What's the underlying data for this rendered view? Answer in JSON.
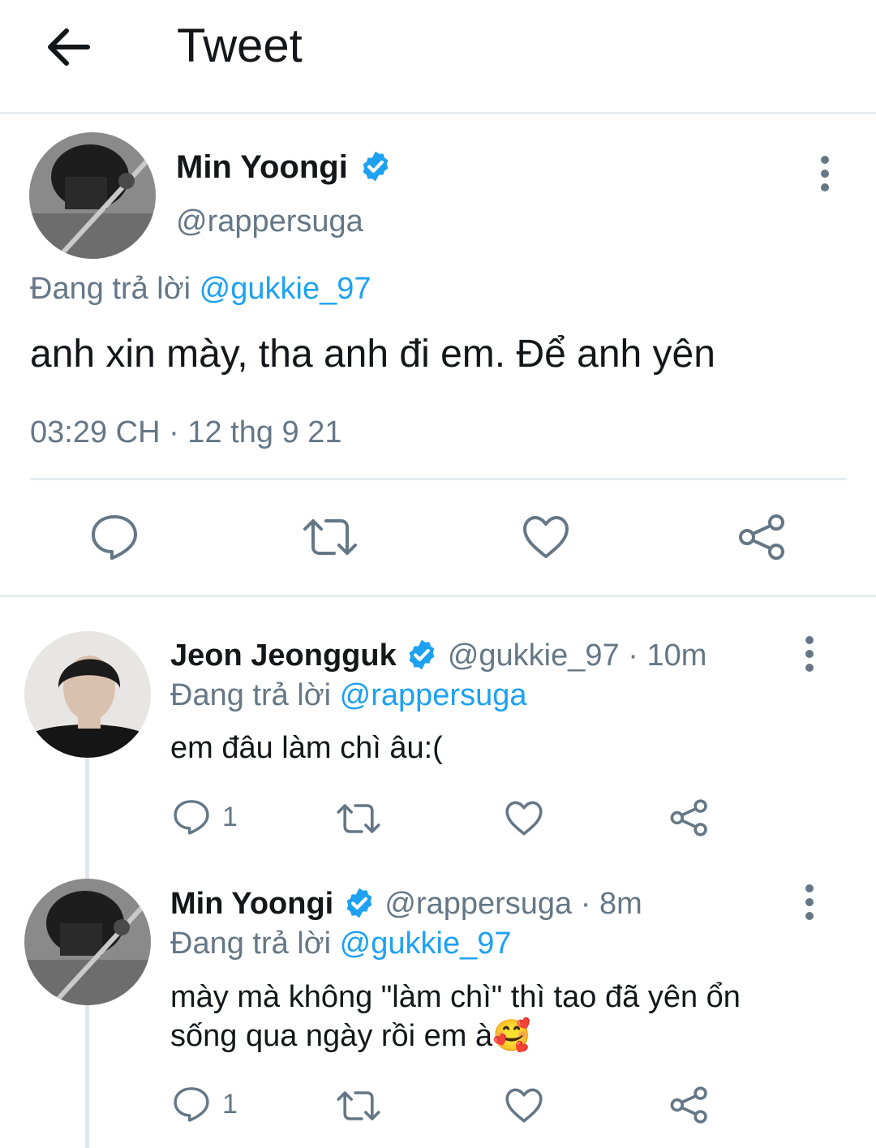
{
  "header": {
    "title": "Tweet"
  },
  "main_tweet": {
    "name": "Min Yoongi",
    "handle": "@rappersuga",
    "replying_prefix": "Đang trả lời",
    "replying_to": "@gukkie_97",
    "text": "anh xin mày, tha anh đi em. Để anh yên",
    "timestamp": "03:29 CH · 12 thg 9 21"
  },
  "replies": [
    {
      "name": "Jeon Jeongguk",
      "handle": "@gukkie_97",
      "time": "· 10m",
      "replying_prefix": "Đang trả lời",
      "replying_to": "@rappersuga",
      "text_lines": [
        "em đâu làm chì âu:("
      ],
      "reply_count": "1"
    },
    {
      "name": "Min Yoongi",
      "handle": "@rappersuga",
      "time": "· 8m",
      "replying_prefix": "Đang trả lời",
      "replying_to": "@gukkie_97",
      "text_lines": [
        "mày mà không \"làm chì\" thì tao đã yên ổn",
        "sống qua ngày rồi em à🥰"
      ],
      "reply_count": "1"
    }
  ],
  "colors": {
    "accent": "#1da1f2",
    "secondary_text": "#657786",
    "divider": "#e6ecf0"
  },
  "icons": [
    "back-arrow-icon",
    "verified-badge-icon",
    "more-vertical-icon",
    "reply-icon",
    "retweet-icon",
    "like-icon",
    "share-icon"
  ]
}
